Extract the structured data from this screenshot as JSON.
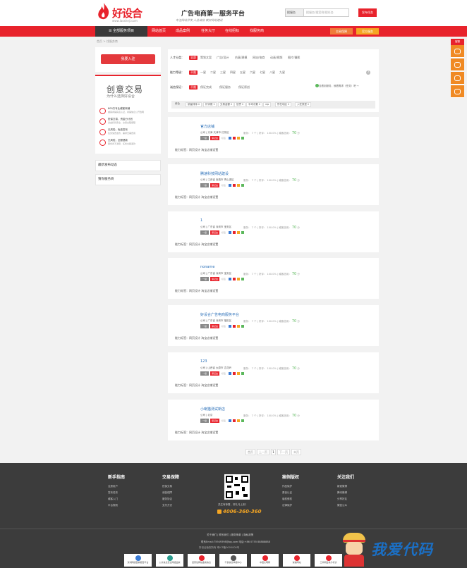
{
  "header": {
    "logo_name": "好设合",
    "logo_url": "www.laosheji.com",
    "slogan": "广告电商第一服务平台",
    "slogan_sub": "专注网站开发 人品诚信 做好网站建设",
    "search_type": "搜服务",
    "search_placeholder": "搜服务/搜案例/搜任务",
    "post_task": "发布任务"
  },
  "nav": {
    "all_services": "全部服务项目",
    "items": [
      "网站首页",
      "成品案例",
      "任务大厅",
      "在线招标",
      "找服务商"
    ],
    "btn1": "交易保障",
    "btn2": "官方服务"
  },
  "breadcrumb": "首页 > 找服务商",
  "sidebar": {
    "entry_btn": "我要入驻",
    "promo_title": "创意交易",
    "promo_sub": "为什么选择好设合",
    "features": [
      {
        "t": "800万专业威客商铺",
        "s": "威客商铺实名认证，商铺信息公开透明"
      },
      {
        "t": "担保交易，资金分计划",
        "s": "资金托管安全，交易全程保障"
      },
      {
        "t": "无风险，免费发布",
        "s": "任务免费发布，需求无需费用"
      },
      {
        "t": "无风险，全额退款",
        "s": "服务商不满意，任务全额退款"
      }
    ],
    "box1": "最新发布动态",
    "box2": "猜你服务商"
  },
  "filter": {
    "rows": [
      {
        "label": "人才分类：",
        "options": [
          "全部",
          "策划文案",
          "广告/设计",
          "仿真/建模",
          "网站/电商",
          "动画/视频",
          "图片/摄影"
        ],
        "active": 0
      },
      {
        "label": "能力等级：",
        "options": [
          "不限",
          "一星",
          "二星",
          "三星",
          "四星",
          "五星",
          "六星",
          "七星",
          "八星",
          "九星"
        ],
        "active": 0
      },
      {
        "label": "诚信保证：",
        "options": [
          "不限",
          "保证完成",
          "保证服务",
          "保证原创"
        ],
        "active": 0
      }
    ],
    "help": "?",
    "hint": "没看到服务，就看需求（任务）吧 →",
    "sort": [
      "综合",
      "销量排序 ▾",
      "好评数 ▾",
      "交易金额 ▾",
      "信誉 ▾",
      "平均次数 ▾",
      "vip",
      "所在地区 ▾",
      "入驻类型 ▾"
    ]
  },
  "providers": [
    {
      "name": "官方店铺",
      "meta": "公司 | 天津 天津市 红桥区",
      "stats": "服务： 7 个 | 好评： 100.0% | 威客信用：",
      "score": "70",
      "ability": "能力标签：网页设计 淘宝店铺设置"
    },
    {
      "name": "腾速科技网站建设",
      "meta": "公司 | 江西省 南昌市 青山湖区",
      "stats": "服务： 7 个 | 好评： 100.0% | 威客信用：",
      "score": "70",
      "ability": "能力标签：网页设计 淘宝店铺设置"
    },
    {
      "name": "1",
      "meta": "公司 | 广东省 深圳市 宝安区",
      "stats": "服务： 7 个 | 好评： 100.0% | 威客信用：",
      "score": "70",
      "ability": "能力标签：网页设计 淘宝店铺设置"
    },
    {
      "name": "noname",
      "meta": "公司 | 广东省 深圳市 宝安区",
      "stats": "服务： 7 个 | 好评： 100.0% | 威客信用：",
      "score": "70",
      "ability": "能力标签：网页设计 淘宝店铺设置"
    },
    {
      "name": "好设合广告电商服务平台",
      "meta": "公司 | 广东省 深圳市 福田区",
      "stats": "服务： 7 个 | 好评： 100.0% | 威客信用：",
      "score": "70",
      "ability": "能力标签：网页设计 淘宝店铺设置"
    },
    {
      "name": "123",
      "meta": "公司 | 山西省 太原市 杏花岭",
      "stats": "服务： 7 个 | 好评： 100.0% | 威客信用：",
      "score": "70",
      "ability": "能力标签：网页设计 淘宝店铺设置"
    },
    {
      "name": "小喇猫测试新店",
      "meta": "公司 | 北京",
      "stats": "服务： 7 个 | 好评： 100.0% | 威客信用：",
      "score": "70",
      "ability": "能力标签：网页设计 淘宝店铺设置"
    }
  ],
  "badges": {
    "level": "一级",
    "tag": "保证金",
    "mark": "标签"
  },
  "pager": [
    "首页",
    "上一页",
    "1",
    "下一页",
    "末页"
  ],
  "footer": {
    "cols": [
      {
        "head": "新手指南",
        "links": [
          "注册用户",
          "发布任务",
          "威客入门",
          "平台规则"
        ]
      },
      {
        "head": "交易保障",
        "links": [
          "担保交易",
          "诚信保障",
          "服务协议",
          "支付方式"
        ]
      },
      {
        "head": "案例版权",
        "links": [
          "作品保护",
          "原创认证",
          "版权侵权",
          "法律保护"
        ]
      },
      {
        "head": "关注我们",
        "links": [
          "新浪微博",
          "腾讯微博",
          "分享好友",
          "微信公众"
        ]
      }
    ],
    "qr_text": "关注有惊喜，好礼马上到！",
    "phone": "4006-360-360",
    "links2": "关于我们 | 联系我们 | 服务条款 | 隐私政策",
    "contact": "联系Email:75949398@qq.com  电话:+86 0755 88888888",
    "copy": "好设合版权所有  粤ICP备0000000号",
    "certs": [
      "深圳网络警察报警平台",
      "公共信息安全网络监察",
      "经营性网站备案信息",
      "不良信息举报中心",
      "中国文明网",
      "诚信网站",
      "工商网监电子标识"
    ],
    "watermark": "我爱代码"
  },
  "right_tabs": {
    "head": "客服"
  },
  "colors": {
    "brand": "#e8232c",
    "orange": "#f08a24",
    "footer": "#3c3c3c"
  }
}
